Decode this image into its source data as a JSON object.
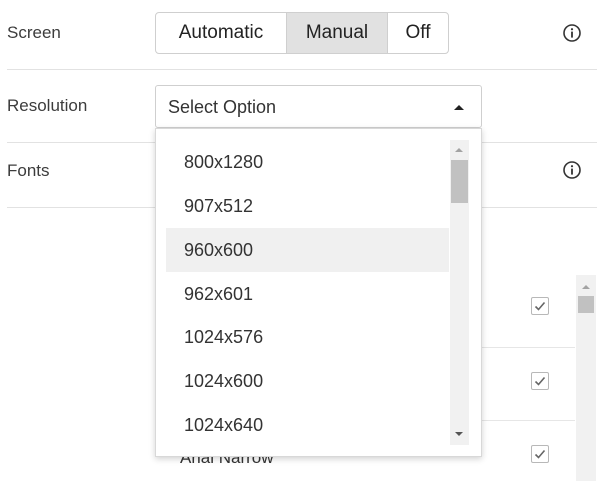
{
  "screen": {
    "label": "Screen",
    "options": [
      "Automatic",
      "Manual",
      "Off"
    ],
    "selected": "Manual"
  },
  "resolution": {
    "label": "Resolution",
    "placeholder": "Select Option",
    "options": [
      "800x1280",
      "907x512",
      "960x600",
      "962x601",
      "1024x576",
      "1024x600",
      "1024x640"
    ],
    "highlighted": "960x600"
  },
  "fonts": {
    "label": "Fonts",
    "partial_item": "Arial Narrow",
    "checked": [
      true,
      true,
      true
    ]
  },
  "icons": {
    "info": "info-icon",
    "caret": "caret-up-icon",
    "check": "check-icon"
  }
}
